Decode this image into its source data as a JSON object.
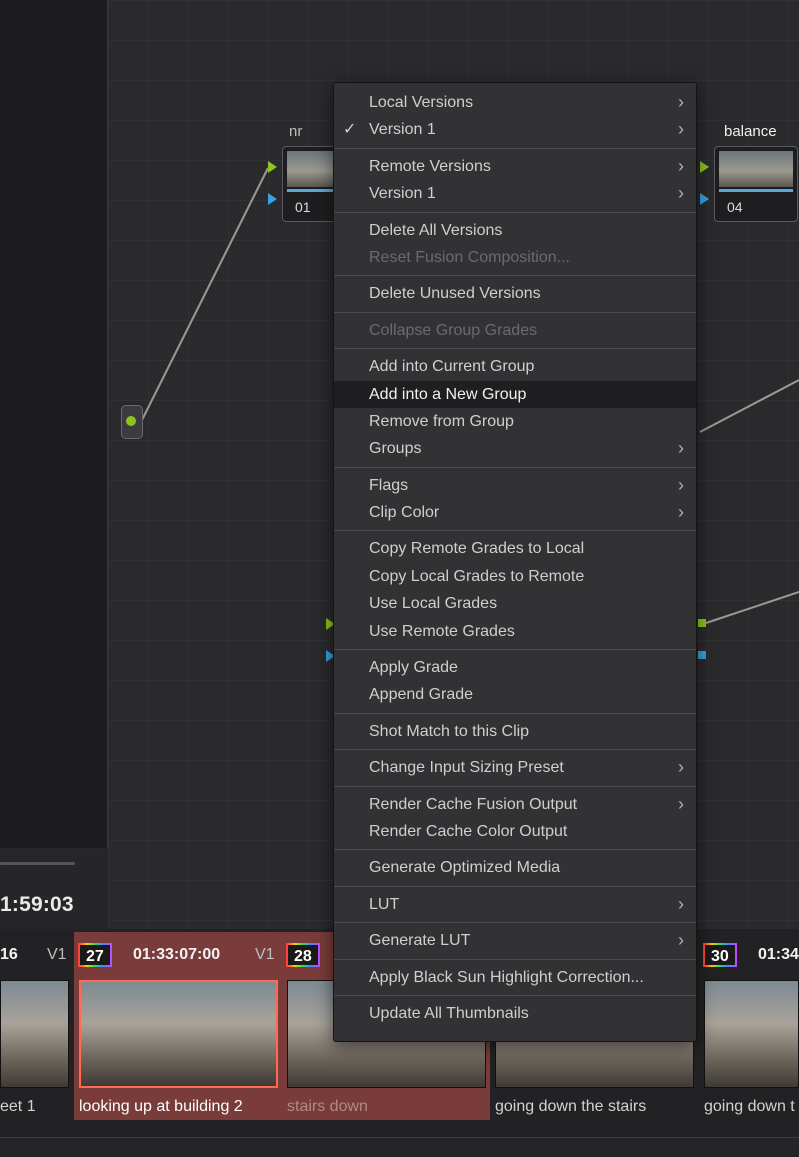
{
  "viewer": {
    "timecode": "1:59:03"
  },
  "nodes": {
    "node1": {
      "label": "nr",
      "number": "01"
    },
    "node2": {
      "label": "balance",
      "number": "04"
    }
  },
  "menu": {
    "items": [
      {
        "label": "Local Versions",
        "submenu": true
      },
      {
        "label": "Version 1",
        "submenu": true,
        "checked": true
      },
      {
        "label": "Remote Versions",
        "submenu": true
      },
      {
        "label": "Version 1",
        "submenu": true
      },
      {
        "label": "Delete All Versions"
      },
      {
        "label": "Reset Fusion Composition...",
        "disabled": true
      },
      {
        "label": "Delete Unused Versions"
      },
      {
        "label": "Collapse Group Grades",
        "disabled": true
      },
      {
        "label": "Add into Current Group"
      },
      {
        "label": "Add into a New Group",
        "highlighted": true
      },
      {
        "label": "Remove from Group"
      },
      {
        "label": "Groups",
        "submenu": true
      },
      {
        "label": "Flags",
        "submenu": true
      },
      {
        "label": "Clip Color",
        "submenu": true
      },
      {
        "label": "Copy Remote Grades to Local"
      },
      {
        "label": "Copy Local Grades to Remote"
      },
      {
        "label": "Use Local Grades"
      },
      {
        "label": "Use Remote Grades"
      },
      {
        "label": "Apply Grade"
      },
      {
        "label": "Append Grade"
      },
      {
        "label": "Shot Match to this Clip"
      },
      {
        "label": "Change Input Sizing Preset",
        "submenu": true
      },
      {
        "label": "Render Cache Fusion Output",
        "submenu": true
      },
      {
        "label": "Render Cache Color Output"
      },
      {
        "label": "Generate Optimized Media"
      },
      {
        "label": "LUT",
        "submenu": true
      },
      {
        "label": "Generate LUT",
        "submenu": true
      },
      {
        "label": "Apply Black Sun Highlight Correction..."
      },
      {
        "label": "Update All Thumbnails"
      }
    ],
    "check_glyph": "✓",
    "arrow_glyph": "›"
  },
  "timeline": {
    "clips": [
      {
        "num": "16",
        "track": "V1",
        "name": "eet 1"
      },
      {
        "num": "27",
        "timecode": "01:33:07:00",
        "track": "V1",
        "name": "looking up at building 2",
        "selected": true
      },
      {
        "num": "28",
        "name": "stairs down"
      },
      {
        "name": "going down the stairs"
      },
      {
        "num": "30",
        "timecode": "01:34",
        "name": "going down t"
      }
    ]
  }
}
